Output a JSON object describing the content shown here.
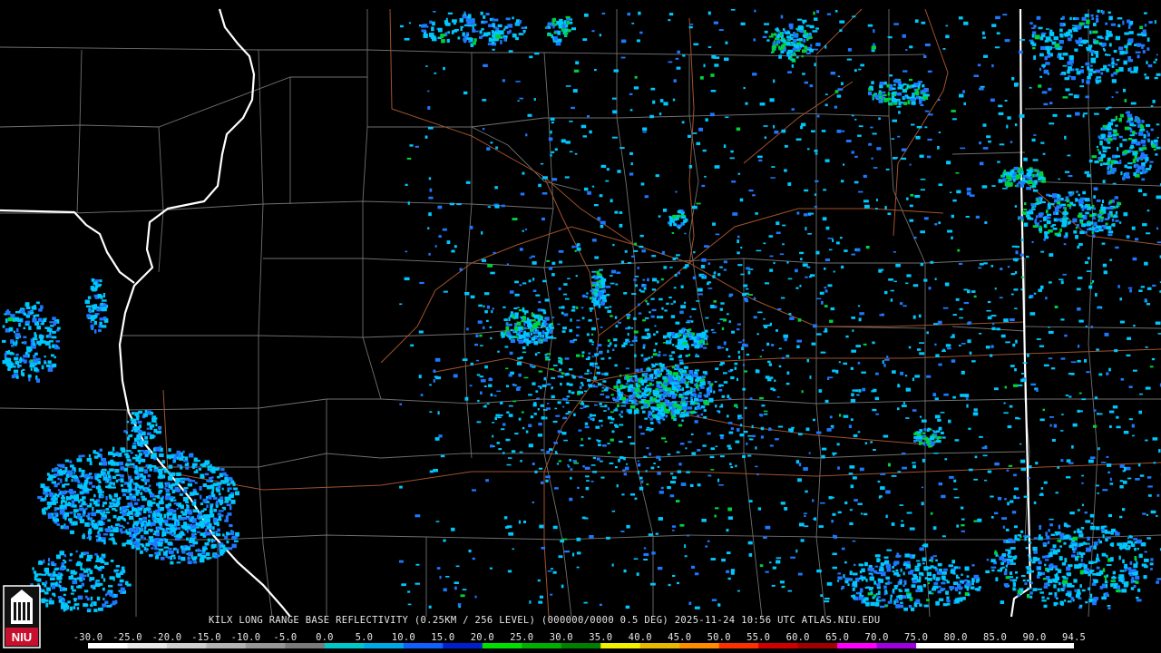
{
  "caption": "KILX LONG RANGE BASE REFLECTIVITY (0.25KM / 256 LEVEL) (000000/0000 0.5 DEG) 2025-11-24 10:56 UTC  ATLAS.NIU.EDU",
  "logo": {
    "text": "NIU",
    "icon": "niu-tower-logo-icon",
    "bg_color": "#c8102e"
  },
  "colorbar": {
    "ticks": [
      "-30.0",
      "-25.0",
      "-20.0",
      "-15.0",
      "-10.0",
      "-5.0",
      "0.0",
      "5.0",
      "10.0",
      "15.0",
      "20.0",
      "25.0",
      "30.0",
      "35.0",
      "40.0",
      "45.0",
      "50.0",
      "55.0",
      "60.0",
      "65.0",
      "70.0",
      "75.0",
      "80.0",
      "85.0",
      "90.0",
      "94.5"
    ],
    "colors": [
      "#ffffff",
      "#e8e8e8",
      "#cfcfcf",
      "#b3b3b3",
      "#979797",
      "#7a7a7a",
      "#00c8c8",
      "#00a8e8",
      "#1060ff",
      "#0020d0",
      "#00e000",
      "#00b000",
      "#008000",
      "#f0f000",
      "#e8b800",
      "#ff8c00",
      "#ff3000",
      "#d00000",
      "#a00000",
      "#ff00ff",
      "#a000e0",
      "#ffffff",
      "#ffffff",
      "#ffffff",
      "#ffffff"
    ]
  },
  "colors": {
    "state_border": "#ffffff",
    "county_line": "#707070",
    "highway": "#a0522d",
    "echo_light": "#00c8ff",
    "echo_mid": "#1e78ff",
    "echo_green": "#00d23c"
  }
}
